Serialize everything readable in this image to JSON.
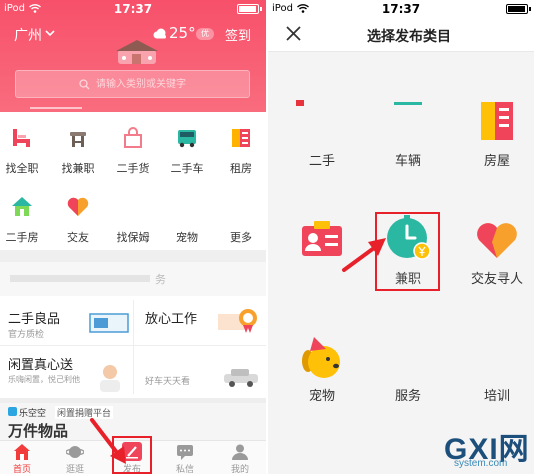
{
  "left": {
    "status": {
      "carrier": "iPod",
      "time": "17:37"
    },
    "header": {
      "city": "广州",
      "temperature": "25°",
      "air_quality": "优",
      "checkin": "签到"
    },
    "search": {
      "placeholder": "请输入类别或关键字"
    },
    "grid": [
      {
        "label": "找全职",
        "icon": "chair-icon"
      },
      {
        "label": "找兼职",
        "icon": "stool-icon"
      },
      {
        "label": "二手货",
        "icon": "bag-icon"
      },
      {
        "label": "二手车",
        "icon": "car-icon"
      },
      {
        "label": "租房",
        "icon": "rent-building-icon"
      },
      {
        "label": "二手房",
        "icon": "house-icon"
      },
      {
        "label": "交友",
        "icon": "heart-icon"
      },
      {
        "label": "找保姆"
      },
      {
        "label": "宠物"
      },
      {
        "label": "更多"
      }
    ],
    "banner": {
      "text": "务"
    },
    "cards": [
      {
        "title": "二手良品",
        "subtitle": "官方质检"
      },
      {
        "title": "放心工作"
      },
      {
        "title": "闲置真心送",
        "subtitle": "乐嗨闲置，悦己利他"
      },
      {
        "subtitle": "好车天天看"
      }
    ],
    "donation": {
      "brand": "乐空空",
      "tagline": "闲置捐赠平台",
      "headline": "万件物品"
    },
    "tabs": [
      {
        "label": "首页",
        "icon": "home-icon",
        "active": true
      },
      {
        "label": "逛逛",
        "icon": "browse-icon"
      },
      {
        "label": "发布",
        "icon": "publish-icon",
        "highlighted": true
      },
      {
        "label": "私信",
        "icon": "chat-icon"
      },
      {
        "label": "我的",
        "icon": "profile-icon"
      }
    ]
  },
  "right": {
    "status": {
      "carrier": "iPod",
      "time": "17:37"
    },
    "header": {
      "title": "选择发布类目",
      "close_icon": "close-icon"
    },
    "categories": [
      {
        "label": "二手",
        "icon": "secondhand-icon"
      },
      {
        "label": "车辆",
        "icon": "vehicle-icon"
      },
      {
        "label": "房屋",
        "icon": "building-icon"
      },
      {
        "icon": "id-card-icon"
      },
      {
        "label": "兼职",
        "icon": "clock-coin-icon",
        "highlighted": true
      },
      {
        "label": "交友寻人",
        "icon": "heart-hands-icon"
      },
      {
        "label": "宠物",
        "icon": "dog-icon"
      },
      {
        "label": "服务"
      },
      {
        "label": "培训"
      }
    ]
  },
  "watermark": {
    "brand": "GXI网",
    "domain": "system.com"
  },
  "colors": {
    "brand_pink": "#F95B6F",
    "annotation_red": "#E8202A",
    "teal": "#2BB8A3",
    "amber": "#FFC107"
  }
}
